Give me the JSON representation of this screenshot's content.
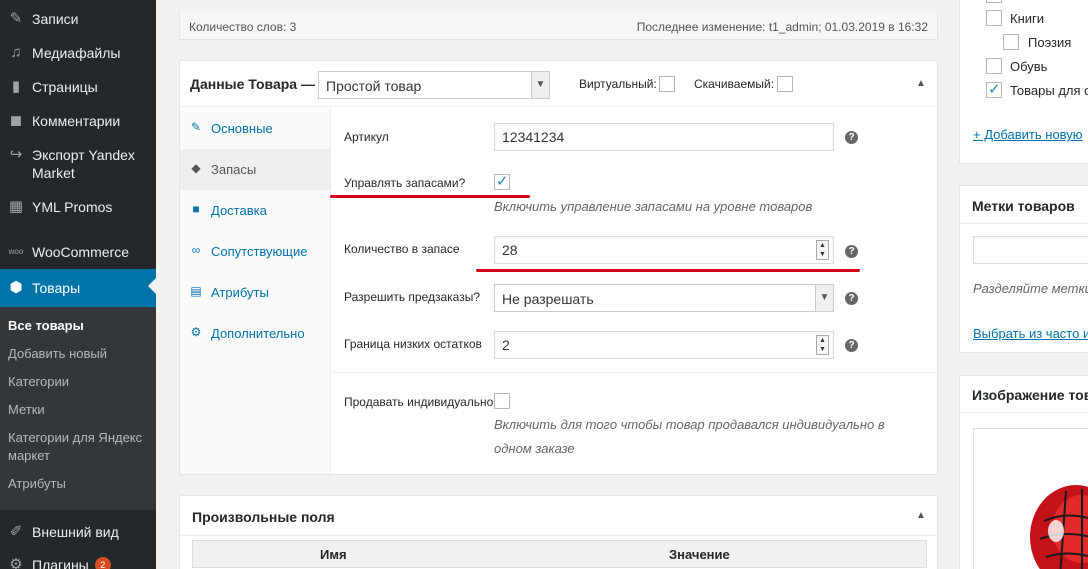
{
  "sidebar": {
    "items": [
      {
        "label": "Записи",
        "icon": "pin-icon"
      },
      {
        "label": "Медиафайлы",
        "icon": "media-icon"
      },
      {
        "label": "Страницы",
        "icon": "page-icon"
      },
      {
        "label": "Комментарии",
        "icon": "comment-icon"
      },
      {
        "label": "Экспорт Yandex Market",
        "icon": "share-icon"
      },
      {
        "label": "YML Promos",
        "icon": "store-icon"
      },
      {
        "label": "WooCommerce",
        "icon": "woo-icon"
      },
      {
        "label": "Товары",
        "icon": "archive-icon"
      },
      {
        "label": "Внешний вид",
        "icon": "brush-icon"
      },
      {
        "label": "Плагины",
        "icon": "plugin-icon",
        "badge": "2"
      }
    ],
    "submenu": [
      "Все товары",
      "Добавить новый",
      "Категории",
      "Метки",
      "Категории для Яндекс маркет",
      "Атрибуты"
    ]
  },
  "editor_status": {
    "word_count": "Количество слов: 3",
    "last_modified": "Последнее изменение: t1_admin; 01.03.2019 в 16:32"
  },
  "product_data": {
    "title": "Данные Товара —",
    "type_selected": "Простой товар",
    "virtual_label": "Виртуальный:",
    "downloadable_label": "Скачиваемый:",
    "tabs": [
      {
        "label": "Основные",
        "icon": "wrench-icon"
      },
      {
        "label": "Запасы",
        "icon": "tag-icon"
      },
      {
        "label": "Доставка",
        "icon": "truck-icon"
      },
      {
        "label": "Сопутствующие",
        "icon": "link-icon"
      },
      {
        "label": "Атрибуты",
        "icon": "list-icon"
      },
      {
        "label": "Дополнительно",
        "icon": "gear-icon"
      }
    ],
    "inventory": {
      "sku_label": "Артикул",
      "sku_value": "12341234",
      "manage_stock_label": "Управлять запасами?",
      "manage_stock_desc": "Включить управление запасами на уровне товаров",
      "stock_qty_label": "Количество в запасе",
      "stock_qty_value": "28",
      "backorders_label": "Разрешить предзаказы?",
      "backorders_value": "Не разрешать",
      "low_stock_label": "Граница низких остатков",
      "low_stock_value": "2",
      "sold_individually_label": "Продавать индивидуально",
      "sold_individually_desc": "Включить для того чтобы товар продавался индивидуально в одном заказе"
    }
  },
  "custom_fields": {
    "title": "Произвольные поля",
    "col_name": "Имя",
    "col_value": "Значение"
  },
  "right_panel": {
    "categories": [
      "Книги",
      "Поэзия",
      "Обувь",
      "Товары для с"
    ],
    "add_category": "+ Добавить новую",
    "tags_title": "Метки товаров",
    "tags_hint": "Разделяйте метки",
    "tags_choose": "Выбрать из часто и",
    "image_title": "Изображение това"
  },
  "colors": {
    "sidebar_bg": "#23282d",
    "submenu_bg": "#32373c",
    "accent": "#0073aa",
    "annotation_red": "#d0021b"
  }
}
